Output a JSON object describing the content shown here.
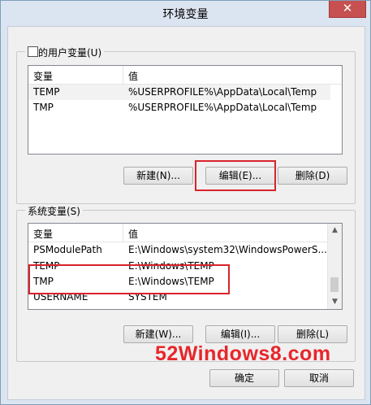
{
  "window": {
    "title": "环境变量",
    "close_label": "✕"
  },
  "user_vars": {
    "group_label": "的用户变量(U)",
    "columns": [
      "变量",
      "值"
    ],
    "rows": [
      {
        "name": "TEMP",
        "value": "%USERPROFILE%\\AppData\\Local\\Temp"
      },
      {
        "name": "TMP",
        "value": "%USERPROFILE%\\AppData\\Local\\Temp"
      }
    ],
    "buttons": {
      "new": "新建(N)...",
      "edit": "编辑(E)...",
      "delete": "删除(D)"
    }
  },
  "system_vars": {
    "group_label": "系统变量(S)",
    "columns": [
      "变量",
      "值"
    ],
    "rows": [
      {
        "name": "PSModulePath",
        "value": "E:\\Windows\\system32\\WindowsPowerS..."
      },
      {
        "name": "TEMP",
        "value": "E:\\Windows\\TEMP"
      },
      {
        "name": "TMP",
        "value": "E:\\Windows\\TEMP"
      },
      {
        "name": "USERNAME",
        "value": "SYSTEM"
      }
    ],
    "buttons": {
      "new": "新建(W)...",
      "edit": "编辑(I)...",
      "delete": "删除(L)"
    }
  },
  "watermark": "52Windows8.com",
  "dialog_buttons": {
    "ok": "确定",
    "cancel": "取消"
  },
  "colors": {
    "highlight_border": "#d9232b",
    "watermark": "#e8262b"
  },
  "icons": {
    "close": "close-icon",
    "scroll_up": "chevron-up-icon",
    "scroll_down": "chevron-down-icon"
  }
}
